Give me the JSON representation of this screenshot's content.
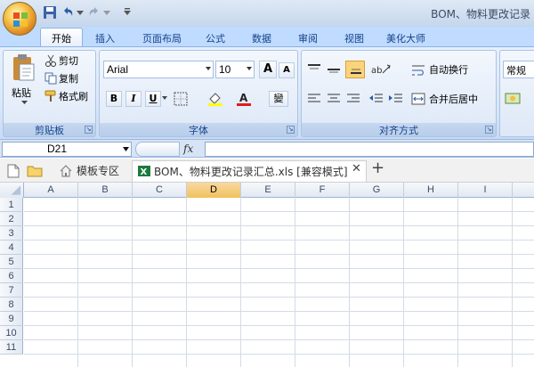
{
  "window": {
    "title": "BOM、物料更改记录"
  },
  "ribbon_tabs": [
    "开始",
    "插入",
    "页面布局",
    "公式",
    "数据",
    "审阅",
    "视图",
    "美化大师"
  ],
  "clipboard": {
    "paste": "粘贴",
    "cut": "剪切",
    "copy": "复制",
    "format_painter": "格式刷",
    "label": "剪贴板"
  },
  "font": {
    "name": "Arial",
    "size": "10",
    "grow": "A",
    "shrink": "A",
    "bold": "B",
    "italic": "I",
    "underline": "U",
    "phonetic": "變",
    "label": "字体"
  },
  "alignment": {
    "wrap": "自动换行",
    "merge": "合并后居中",
    "label": "对齐方式"
  },
  "number": {
    "format": "常规"
  },
  "formula_bar": {
    "name_box": "D21",
    "fx": "fx",
    "value": ""
  },
  "doc_tabs": {
    "template_label": "模板专区",
    "file_label": "BOM、物料更改记录汇总.xls [兼容模式]",
    "close": "✕",
    "add": "+"
  },
  "grid": {
    "columns": [
      "A",
      "B",
      "C",
      "D",
      "E",
      "F",
      "G",
      "H",
      "I"
    ],
    "selected_column": "D",
    "rows": [
      "1",
      "2",
      "3",
      "4",
      "5",
      "6",
      "7",
      "8",
      "9",
      "10",
      "11"
    ]
  },
  "colors": {
    "accent": "#15428b",
    "selected_header": "#f1c15f",
    "ribbon": "#dbe8f8"
  }
}
